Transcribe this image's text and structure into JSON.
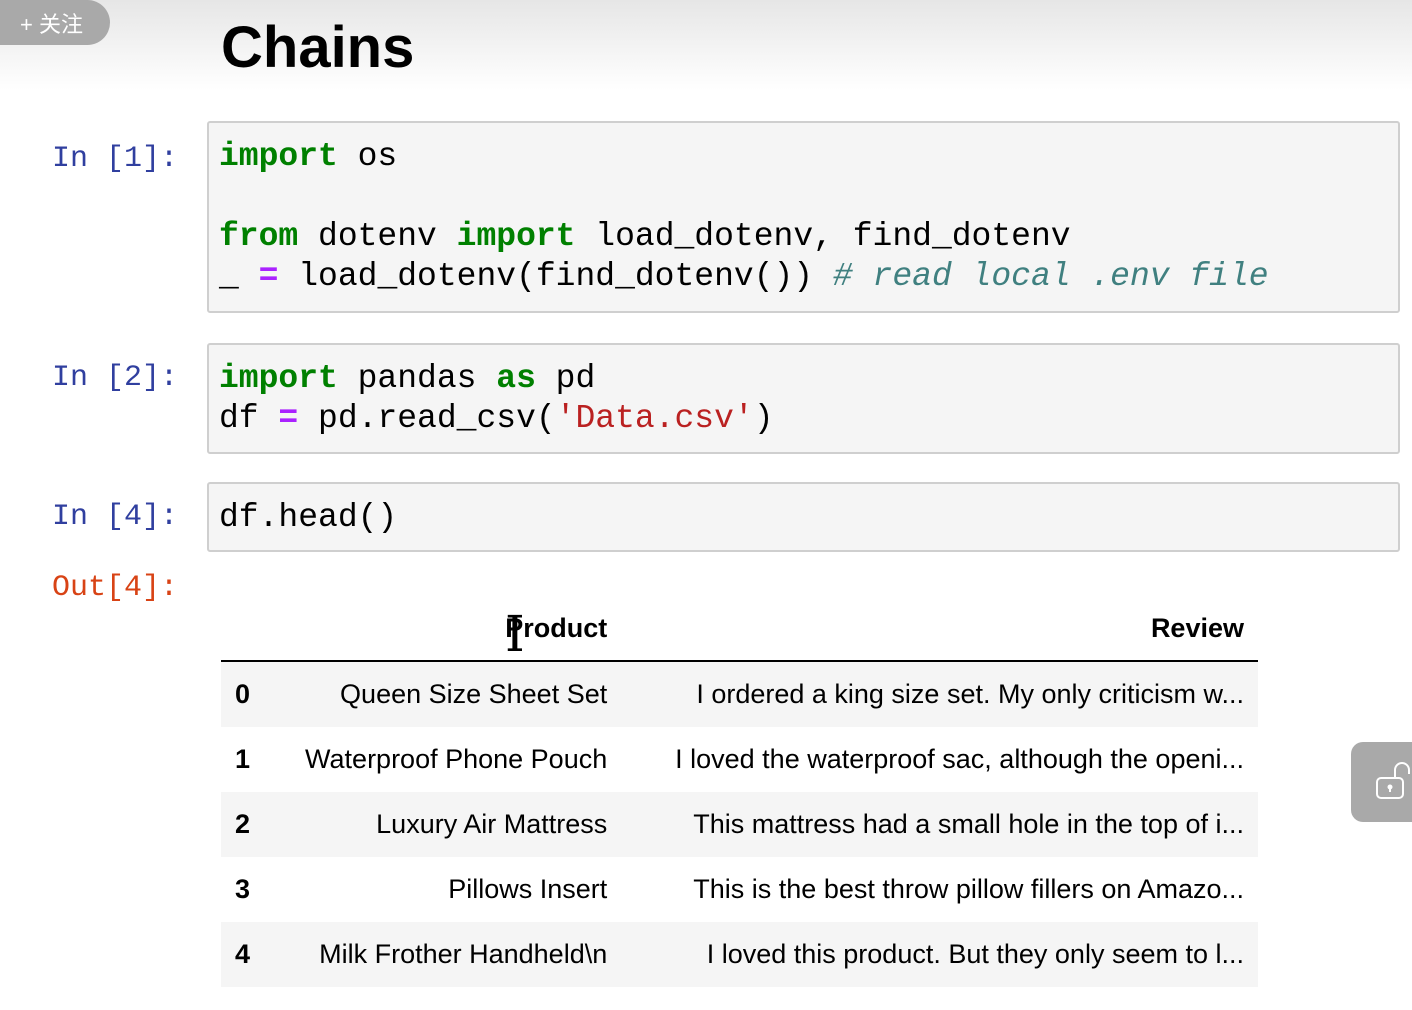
{
  "overlay": {
    "follow_label": "+ 关注"
  },
  "title": "Chains",
  "cells": [
    {
      "prompt": "In [1]:"
    },
    {
      "prompt": "In [2]:"
    },
    {
      "prompt": "In [4]:"
    }
  ],
  "code": {
    "c1": {
      "import": "import",
      "os": " os",
      "from": "from",
      "dotenv": " dotenv ",
      "import2": "import",
      "names": " load_dotenv, find_dotenv",
      "us": "_ ",
      "eq": "=",
      "call": " load_dotenv(find_dotenv()) ",
      "comment": "# read local .env file"
    },
    "c2": {
      "import": "import",
      "pandas": " pandas ",
      "as": "as",
      "pd": " pd",
      "df": "df ",
      "eq": "=",
      "read": " pd.read_csv(",
      "str": "'Data.csv'",
      "close": ")"
    },
    "c3": {
      "code": "df.head()"
    }
  },
  "output": {
    "prompt": "Out[4]:",
    "columns": [
      "",
      "Product",
      "Review"
    ],
    "rows": [
      [
        "0",
        "Queen Size Sheet Set",
        "I ordered a king size set. My only criticism w..."
      ],
      [
        "1",
        "Waterproof Phone Pouch",
        "I loved the waterproof sac, although the openi..."
      ],
      [
        "2",
        "Luxury Air Mattress",
        "This mattress had a small hole in the top of i..."
      ],
      [
        "3",
        "Pillows Insert",
        "This is the best throw pillow fillers on Amazo..."
      ],
      [
        "4",
        "Milk Frother Handheld\\n",
        "I loved this product. But they only seem to l..."
      ]
    ]
  },
  "icons": {
    "lock": "unlock-icon",
    "cursor": "text-cursor-icon"
  }
}
